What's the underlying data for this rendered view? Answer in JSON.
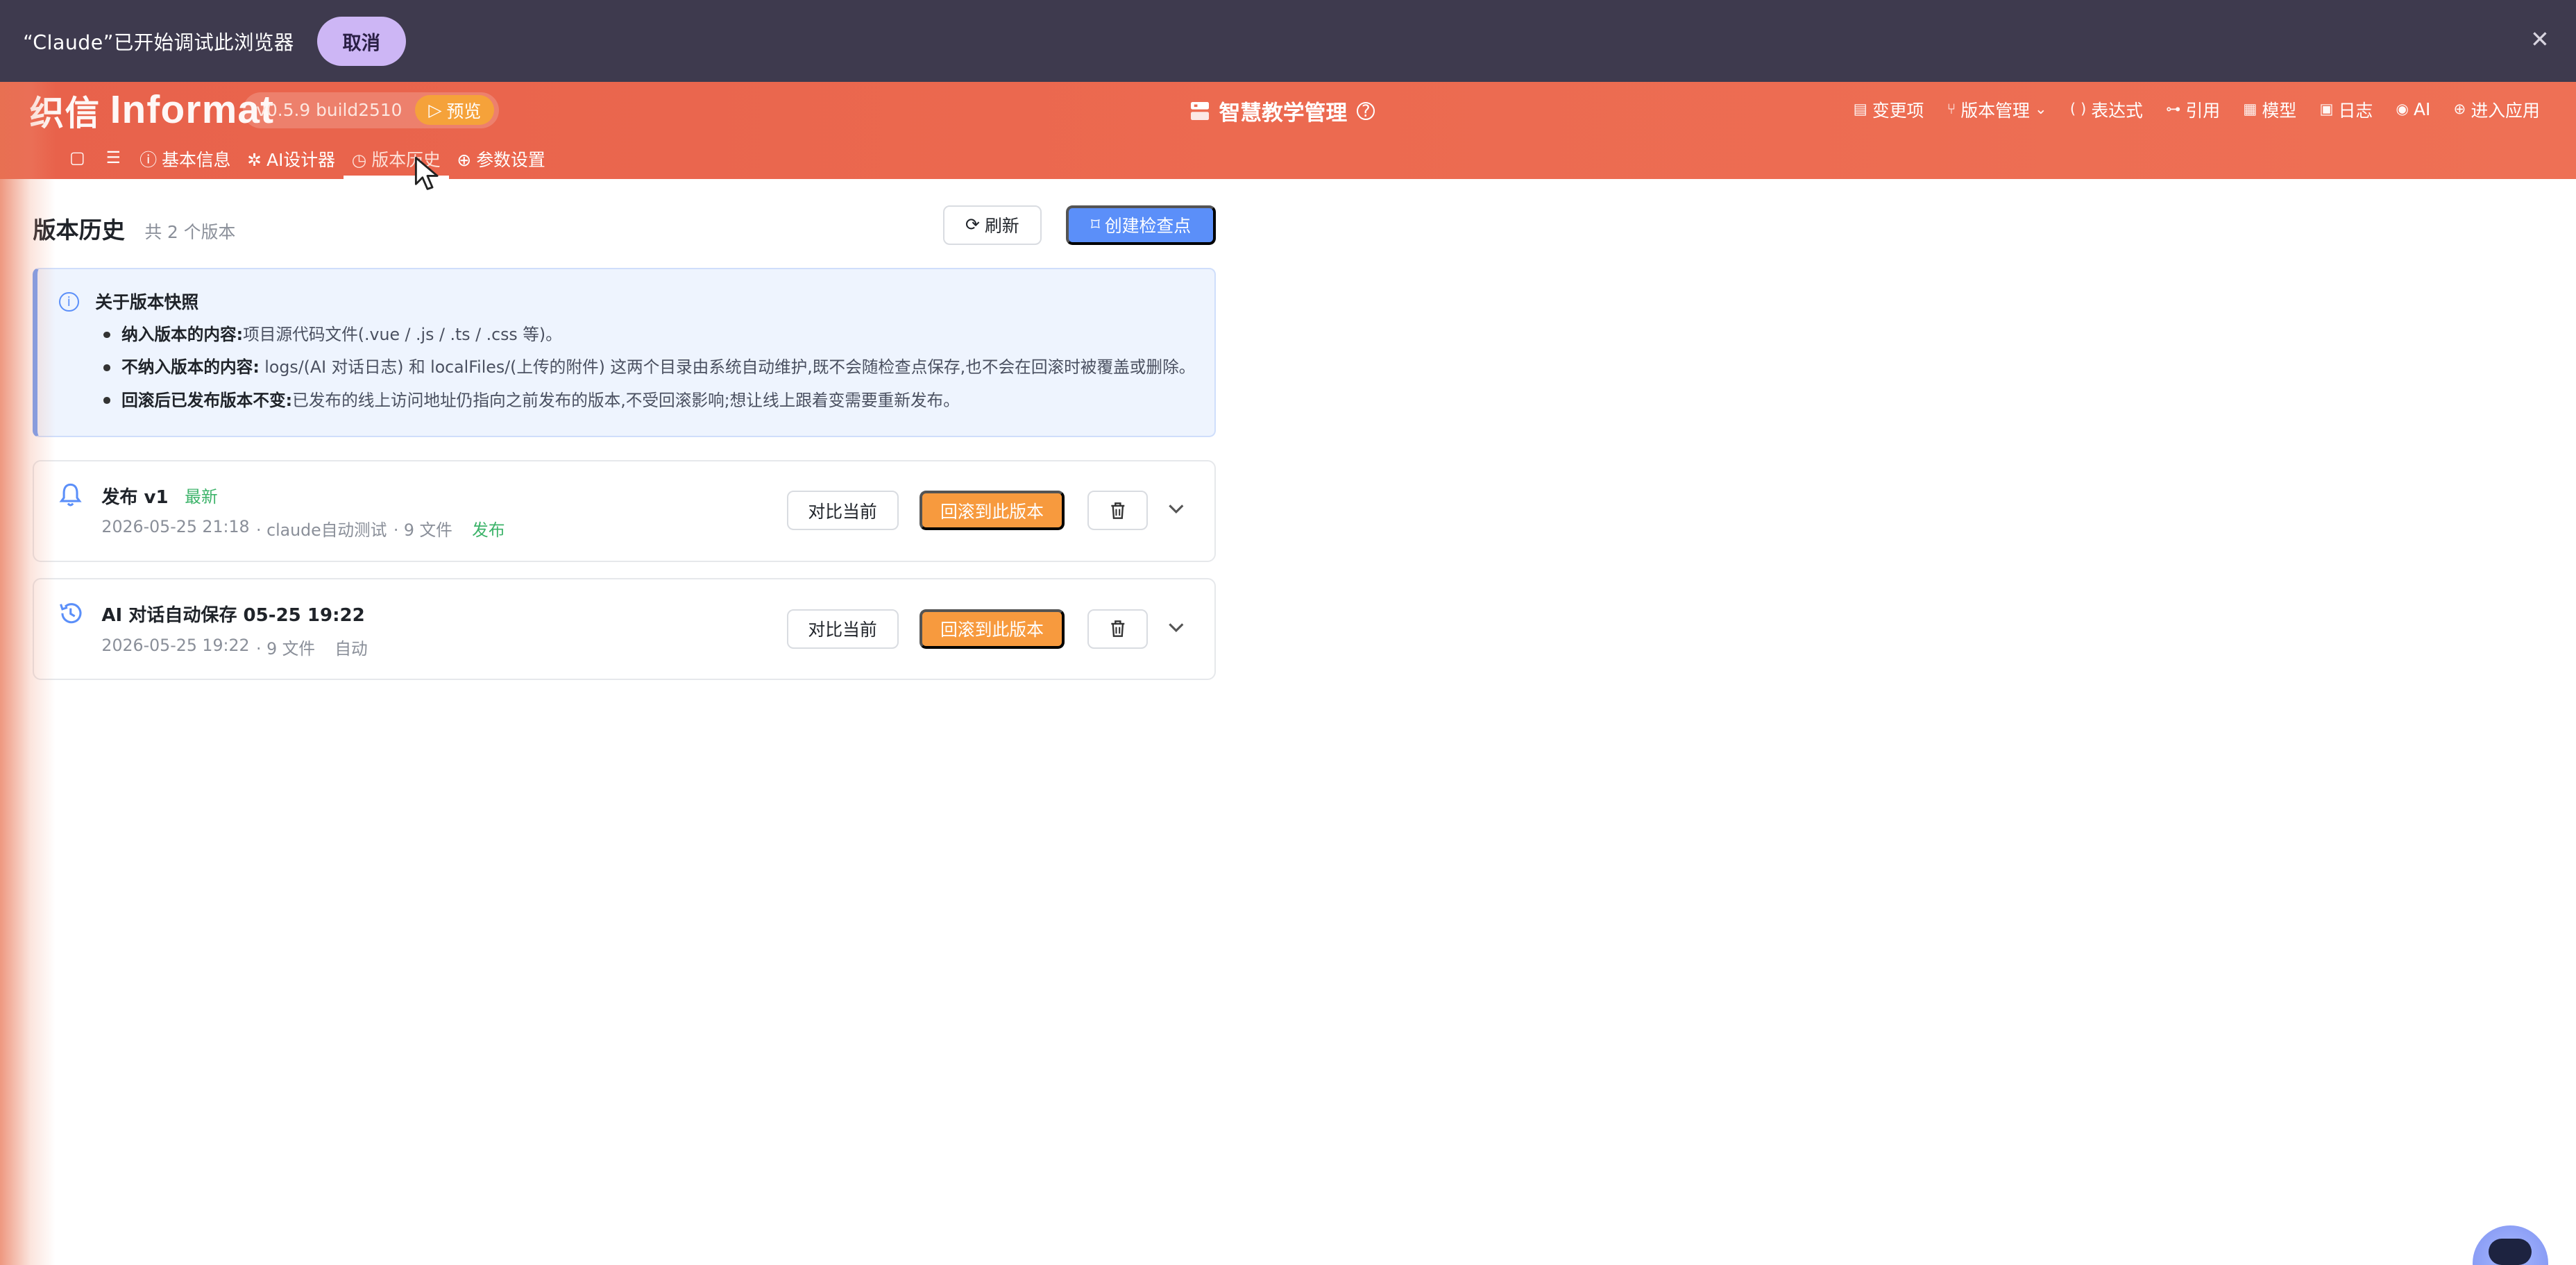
{
  "debug_bar": {
    "message": "“Claude”已开始调试此浏览器",
    "cancel_label": "取消",
    "close_glyph": "✕"
  },
  "header": {
    "logo_cn": "织信",
    "logo_en": "Informat",
    "version": "v0.5.9 build2510",
    "preview_label": "预览",
    "app_title": "智慧教学管理",
    "actions": [
      {
        "label": "变更项",
        "icon": "list-icon"
      },
      {
        "label": "版本管理",
        "icon": "branch-icon"
      },
      {
        "label": "表达式",
        "icon": "braces-icon"
      },
      {
        "label": "引用",
        "icon": "reference-icon"
      },
      {
        "label": "模型",
        "icon": "table-icon"
      },
      {
        "label": "日志",
        "icon": "log-icon"
      },
      {
        "label": "AI",
        "icon": "user-circle-icon"
      },
      {
        "label": "进入应用",
        "icon": "enter-icon"
      }
    ],
    "tabs": [
      {
        "label": "基本信息",
        "icon": "info-icon"
      },
      {
        "label": "AI设计器",
        "icon": "designer-icon"
      },
      {
        "label": "版本历史",
        "icon": "history-icon"
      },
      {
        "label": "参数设置",
        "icon": "globe-icon"
      }
    ],
    "active_tab": "版本历史"
  },
  "page": {
    "title": "版本历史",
    "count": "共 2 个版本",
    "refresh_label": "刷新",
    "checkpoint_label": "创建检查点"
  },
  "info": {
    "title": "关于版本快照",
    "items": [
      {
        "bold": "纳入版本的内容:",
        "text": "项目源代码文件(.vue / .js / .ts / .css 等)。"
      },
      {
        "bold": "不纳入版本的内容:",
        "text": " logs/(AI 对话日志) 和 localFiles/(上传的附件) 这两个目录由系统自动维护,既不会随检查点保存,也不会在回滚时被覆盖或删除。"
      },
      {
        "bold": "回滚后已发布版本不变:",
        "text": "已发布的线上访问地址仍指向之前发布的版本,不受回滚影响;想让线上跟着变需要重新发布。"
      }
    ]
  },
  "versions": [
    {
      "title": "发布 v1",
      "badge": "最新",
      "time": "2026-05-25 21:18",
      "author": "· claude自动测试",
      "files": "· 9 文件",
      "tag": "发布",
      "icon": "bell-icon",
      "compare_label": "对比当前",
      "rollback_label": "回滚到此版本"
    },
    {
      "title": "AI 对话自动保存 05-25 19:22",
      "badge": "",
      "time": "2026-05-25 19:22",
      "author": "",
      "files": "· 9 文件",
      "tag": "自动",
      "icon": "history-icon",
      "compare_label": "对比当前",
      "rollback_label": "回滚到此版本"
    }
  ],
  "colors": {
    "header_accent": "#ec6a50",
    "primary_blue": "#5b8ff9",
    "rollback_orange": "#f79a3e",
    "success_green": "#3db36a"
  }
}
